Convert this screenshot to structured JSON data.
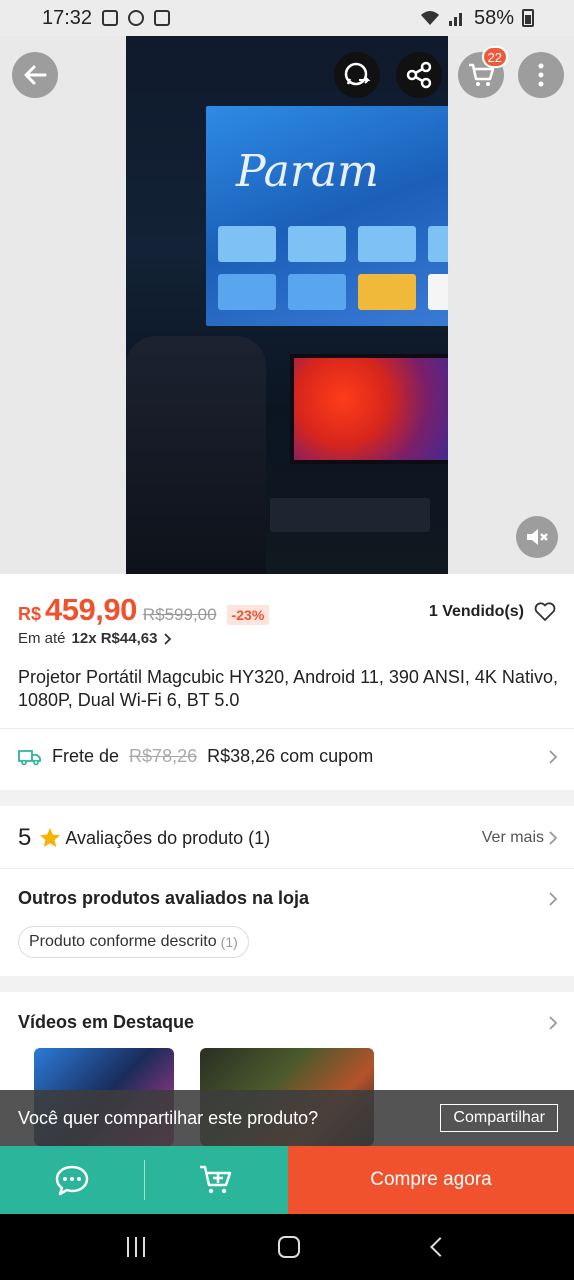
{
  "status_bar": {
    "time": "17:32",
    "battery": "58%"
  },
  "header": {
    "cart_count": "22"
  },
  "product": {
    "currency": "R$",
    "price": "459,90",
    "old_price": "R$599,00",
    "discount": "-23%",
    "sold": "1 Vendido(s)",
    "installment_prefix": "Em até",
    "installment_value": "12x R$44,63",
    "title": "Projetor Portátil Magcubic HY320, Android 11, 390 ANSI, 4K Nativo, 1080P, Dual Wi-Fi 6, BT 5.0"
  },
  "video_preview": {
    "tv_brand": "Param"
  },
  "shipping": {
    "label": "Frete de",
    "old_price": "R$78,26",
    "new_price": "R$38,26 com cupom"
  },
  "reviews": {
    "rating": "5",
    "title": "Avaliações do produto (1)",
    "see_more": "Ver mais",
    "other_title": "Outros produtos avaliados na loja",
    "chip_label": "Produto conforme descrito",
    "chip_count": "(1)"
  },
  "videos": {
    "title": "Vídeos em Destaque"
  },
  "share_toast": {
    "message": "Você quer compartilhar este produto?",
    "button": "Compartilhar"
  },
  "bottom_bar": {
    "buy_label": "Compre agora"
  },
  "colors": {
    "accent": "#f0522d",
    "green": "#2bb59a"
  }
}
